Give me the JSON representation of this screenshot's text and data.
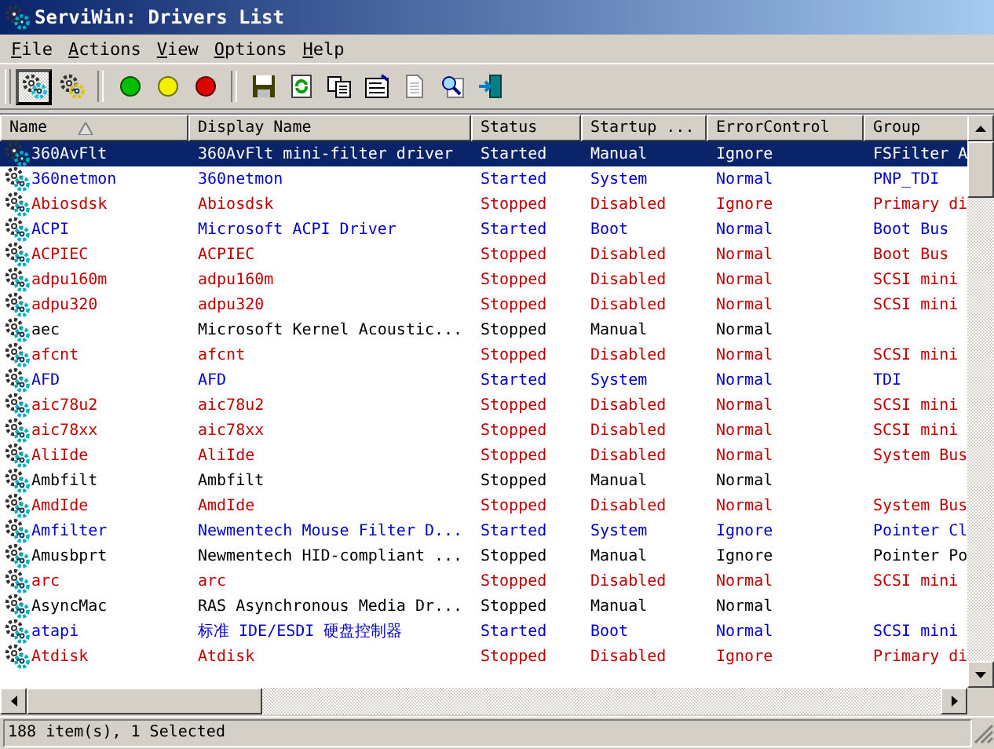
{
  "window": {
    "title": "ServiWin: Drivers List"
  },
  "menu": [
    "File",
    "Actions",
    "View",
    "Options",
    "Help"
  ],
  "toolbar": [
    {
      "kind": "drivers",
      "pressed": true
    },
    {
      "kind": "services",
      "pressed": false
    },
    {
      "kind": "sep"
    },
    {
      "kind": "start"
    },
    {
      "kind": "pause"
    },
    {
      "kind": "stop"
    },
    {
      "kind": "sep"
    },
    {
      "kind": "save"
    },
    {
      "kind": "refresh"
    },
    {
      "kind": "copy"
    },
    {
      "kind": "properties"
    },
    {
      "kind": "report"
    },
    {
      "kind": "find"
    },
    {
      "kind": "exit"
    }
  ],
  "table": {
    "columns": [
      "Name",
      "Display Name",
      "Status",
      "Startup ...",
      "ErrorControl",
      "Group"
    ],
    "rows": [
      {
        "selected": true,
        "cells": [
          "360AvFlt",
          "360AvFlt mini-filter driver",
          "Started",
          "Manual",
          "Ignore",
          "FSFilter A"
        ]
      },
      {
        "selected": false,
        "color": "#0000cc",
        "cells": [
          "360netmon",
          "360netmon",
          "Started",
          "System",
          "Normal",
          "PNP_TDI"
        ]
      },
      {
        "selected": false,
        "color": "#c00000",
        "cells": [
          "Abiosdsk",
          "Abiosdsk",
          "Stopped",
          "Disabled",
          "Ignore",
          "Primary di"
        ]
      },
      {
        "selected": false,
        "color": "#0000cc",
        "cells": [
          "ACPI",
          "Microsoft ACPI Driver",
          "Started",
          "Boot",
          "Normal",
          "Boot Bus"
        ]
      },
      {
        "selected": false,
        "color": "#c00000",
        "cells": [
          "ACPIEC",
          "ACPIEC",
          "Stopped",
          "Disabled",
          "Normal",
          "Boot Bus"
        ]
      },
      {
        "selected": false,
        "color": "#c00000",
        "cells": [
          "adpu160m",
          "adpu160m",
          "Stopped",
          "Disabled",
          "Normal",
          "SCSI mini"
        ]
      },
      {
        "selected": false,
        "color": "#c00000",
        "cells": [
          "adpu320",
          "adpu320",
          "Stopped",
          "Disabled",
          "Normal",
          "SCSI mini"
        ]
      },
      {
        "selected": false,
        "color": "#000000",
        "cells": [
          "aec",
          "Microsoft Kernel Acoustic...",
          "Stopped",
          "Manual",
          "Normal",
          ""
        ]
      },
      {
        "selected": false,
        "color": "#c00000",
        "cells": [
          "afcnt",
          "afcnt",
          "Stopped",
          "Disabled",
          "Normal",
          "SCSI mini"
        ]
      },
      {
        "selected": false,
        "color": "#0000cc",
        "cells": [
          "AFD",
          "AFD",
          "Started",
          "System",
          "Normal",
          "TDI"
        ]
      },
      {
        "selected": false,
        "color": "#c00000",
        "cells": [
          "aic78u2",
          "aic78u2",
          "Stopped",
          "Disabled",
          "Normal",
          "SCSI mini"
        ]
      },
      {
        "selected": false,
        "color": "#c00000",
        "cells": [
          "aic78xx",
          "aic78xx",
          "Stopped",
          "Disabled",
          "Normal",
          "SCSI mini"
        ]
      },
      {
        "selected": false,
        "color": "#c00000",
        "cells": [
          "AliIde",
          "AliIde",
          "Stopped",
          "Disabled",
          "Normal",
          "System Bus"
        ]
      },
      {
        "selected": false,
        "color": "#000000",
        "cells": [
          "Ambfilt",
          "Ambfilt",
          "Stopped",
          "Manual",
          "Normal",
          ""
        ]
      },
      {
        "selected": false,
        "color": "#c00000",
        "cells": [
          "AmdIde",
          "AmdIde",
          "Stopped",
          "Disabled",
          "Normal",
          "System Bus"
        ]
      },
      {
        "selected": false,
        "color": "#0000cc",
        "cells": [
          "Amfilter",
          "Newmentech Mouse Filter D...",
          "Started",
          "System",
          "Ignore",
          "Pointer Cl"
        ]
      },
      {
        "selected": false,
        "color": "#000000",
        "cells": [
          "Amusbprt",
          "Newmentech HID-compliant ...",
          "Stopped",
          "Manual",
          "Ignore",
          "Pointer Po"
        ]
      },
      {
        "selected": false,
        "color": "#c00000",
        "cells": [
          "arc",
          "arc",
          "Stopped",
          "Disabled",
          "Normal",
          "SCSI mini"
        ]
      },
      {
        "selected": false,
        "color": "#000000",
        "cells": [
          "AsyncMac",
          "RAS Asynchronous Media Dr...",
          "Stopped",
          "Manual",
          "Normal",
          ""
        ]
      },
      {
        "selected": false,
        "color": "#0000cc",
        "cells": [
          "atapi",
          "标准 IDE/ESDI 硬盘控制器",
          "Started",
          "Boot",
          "Normal",
          "SCSI mini"
        ]
      },
      {
        "selected": false,
        "color": "#c00000",
        "cells": [
          "Atdisk",
          "Atdisk",
          "Stopped",
          "Disabled",
          "Ignore",
          "Primary di"
        ]
      }
    ]
  },
  "status_bar": "188 item(s), 1 Selected"
}
